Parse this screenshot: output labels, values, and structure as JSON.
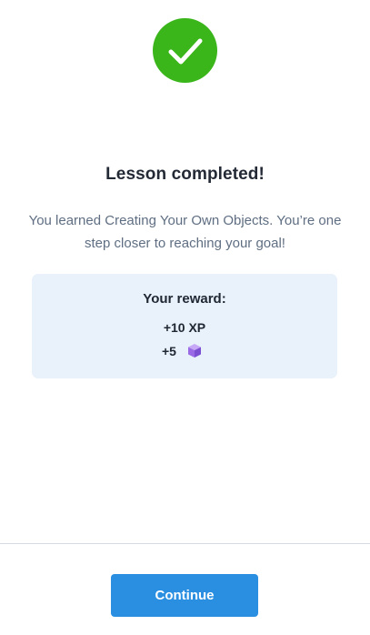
{
  "completion": {
    "icon": "checkmark-icon",
    "icon_color": "#3ab51a",
    "title": "Lesson completed!",
    "message": "You learned Creating Your Own Objects. You’re one step closer to reaching your goal!"
  },
  "reward": {
    "title": "Your reward:",
    "xp": "+10 XP",
    "gems": "+5",
    "gem_icon": "purple-gem-icon",
    "card_color": "#e9f1fb"
  },
  "footer": {
    "continue_label": "Continue",
    "button_color": "#2a8fe0"
  }
}
